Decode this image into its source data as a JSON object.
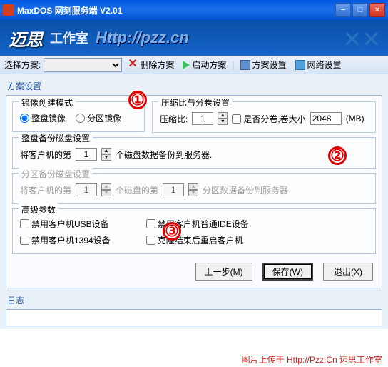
{
  "window": {
    "title": "MaxDOS 网刻服务端 V2.01"
  },
  "banner": {
    "logo": "迈思",
    "sub": "工作室",
    "url": "Http://pzz.cn"
  },
  "toolbar": {
    "select_plan": "选择方案:",
    "delete_plan": "删除方案",
    "start_plan": "启动方案",
    "plan_settings": "方案设置",
    "network_settings": "网络设置"
  },
  "section": {
    "title": "方案设置"
  },
  "image_mode": {
    "legend": "镜像创建模式",
    "full_disk": "整盘镜像",
    "partition": "分区镜像"
  },
  "compress": {
    "legend": "压缩比与分卷设置",
    "ratio_label": "压缩比:",
    "ratio_value": "1",
    "split_label": "是否分卷,卷大小",
    "split_value": "2048",
    "unit": "(MB)"
  },
  "fulldisk_backup": {
    "legend": "整盘备份磁盘设置",
    "pre": "将客户机的第",
    "value": "1",
    "post": "个磁盘数据备份到服务器."
  },
  "partition_backup": {
    "legend": "分区备份磁盘设置",
    "pre": "将客户机的第",
    "v1": "1",
    "mid": "个磁盘的第",
    "v2": "1",
    "post": "分区数据备份到服务器."
  },
  "advanced": {
    "legend": "高级参数",
    "disable_usb": "禁用客户机USB设备",
    "disable_1394": "禁用客户机1394设备",
    "disable_ide": "禁用客户机普通IDE设备",
    "reboot_after": "克隆结束后重启客户机"
  },
  "buttons": {
    "prev": "上一步(M)",
    "save": "保存(W)",
    "exit": "退出(X)"
  },
  "log": {
    "title": "日志"
  },
  "footer": "图片上传于 Http://Pzz.Cn 迈思工作室",
  "markers": {
    "m1": "①",
    "m2": "②",
    "m3": "③"
  }
}
